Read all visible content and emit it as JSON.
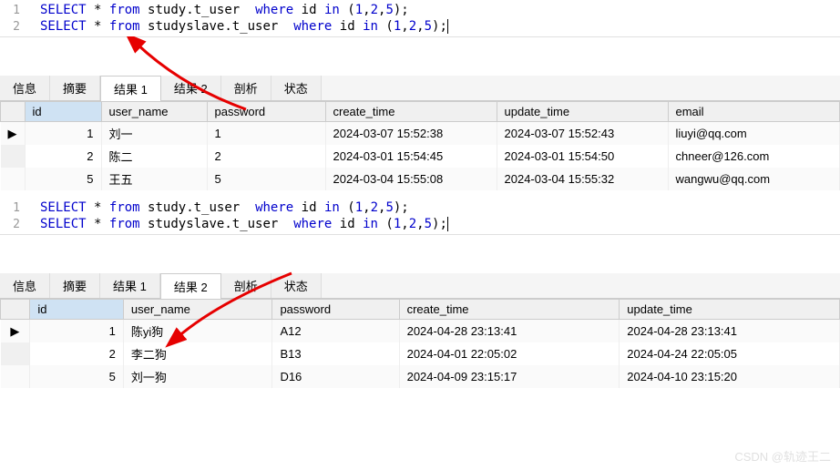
{
  "editor1": {
    "lines": [
      {
        "n": "1",
        "sql_html": "SELECT * from study.t_user  where id in (1,2,5);"
      },
      {
        "n": "2",
        "sql_html": "SELECT * from studyslave.t_user  where id in (1,2,5);"
      }
    ]
  },
  "tabs1": {
    "items": [
      "信息",
      "摘要",
      "结果 1",
      "结果 2",
      "剖析",
      "状态"
    ],
    "active": 2
  },
  "table1": {
    "headers": [
      "id",
      "user_name",
      "password",
      "create_time",
      "update_time",
      "email"
    ],
    "rows": [
      {
        "id": "1",
        "user_name": "刘一",
        "password": "1",
        "create_time": "2024-03-07 15:52:38",
        "update_time": "2024-03-07 15:52:43",
        "email": "liuyi@qq.com"
      },
      {
        "id": "2",
        "user_name": "陈二",
        "password": "2",
        "create_time": "2024-03-01 15:54:45",
        "update_time": "2024-03-01 15:54:50",
        "email": "chneer@126.com"
      },
      {
        "id": "5",
        "user_name": "王五",
        "password": "5",
        "create_time": "2024-03-04 15:55:08",
        "update_time": "2024-03-04 15:55:32",
        "email": "wangwu@qq.com"
      }
    ]
  },
  "editor2": {
    "lines": [
      {
        "n": "1",
        "sql_html": "SELECT * from study.t_user  where id in (1,2,5);"
      },
      {
        "n": "2",
        "sql_html": "SELECT * from studyslave.t_user  where id in (1,2,5);"
      }
    ]
  },
  "tabs2": {
    "items": [
      "信息",
      "摘要",
      "结果 1",
      "结果 2",
      "剖析",
      "状态"
    ],
    "active": 3
  },
  "table2": {
    "headers": [
      "id",
      "user_name",
      "password",
      "create_time",
      "update_time"
    ],
    "rows": [
      {
        "id": "1",
        "user_name": "陈yi狗",
        "password": "A12",
        "create_time": "2024-04-28 23:13:41",
        "update_time": "2024-04-28 23:13:41"
      },
      {
        "id": "2",
        "user_name": "李二狗",
        "password": "B13",
        "create_time": "2024-04-01 22:05:02",
        "update_time": "2024-04-24 22:05:05"
      },
      {
        "id": "5",
        "user_name": "刘一狗",
        "password": "D16",
        "create_time": "2024-04-09 23:15:17",
        "update_time": "2024-04-10 23:15:20"
      }
    ]
  },
  "watermark": "CSDN @轨迹王二",
  "row_marker": "▶"
}
